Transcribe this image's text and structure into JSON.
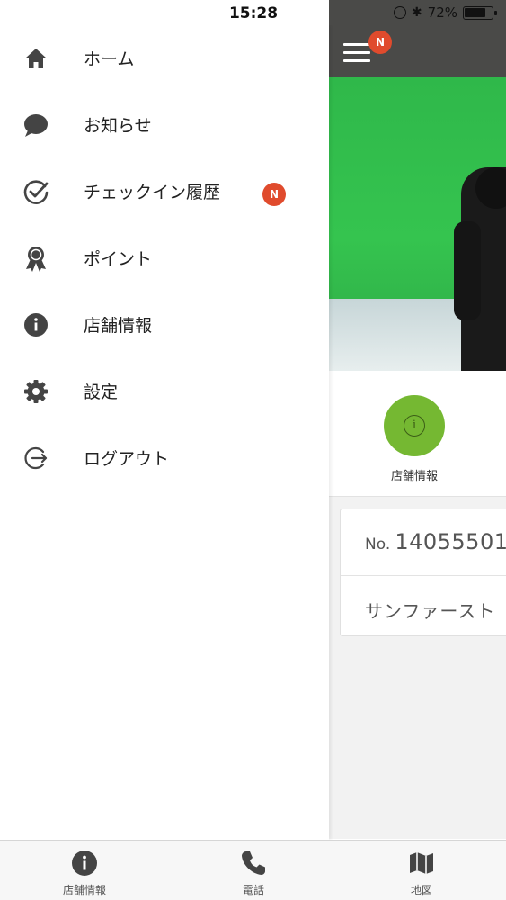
{
  "status_bar": {
    "time": "15:28",
    "battery": "72%"
  },
  "app": {
    "header_badge": "N",
    "store_info_label": "店舗情報",
    "member_no_prefix": "No.",
    "member_no": "14055501",
    "member_name": "サンファースト"
  },
  "drawer": {
    "items": [
      {
        "label": "ホーム",
        "icon": "home-icon"
      },
      {
        "label": "お知らせ",
        "icon": "speech-bubble-icon"
      },
      {
        "label": "チェックイン履歴",
        "icon": "check-circle-icon",
        "badge": "N"
      },
      {
        "label": "ポイント",
        "icon": "award-ribbon-icon"
      },
      {
        "label": "店舗情報",
        "icon": "info-icon"
      },
      {
        "label": "設定",
        "icon": "gear-icon"
      },
      {
        "label": "ログアウト",
        "icon": "logout-icon"
      }
    ]
  },
  "tab_bar": {
    "tabs": [
      {
        "label": "店舗情報",
        "icon": "info-icon"
      },
      {
        "label": "電話",
        "icon": "phone-icon"
      },
      {
        "label": "地図",
        "icon": "map-icon"
      }
    ]
  },
  "colors": {
    "accent_green": "#75b832",
    "badge_red": "#e04b2d",
    "header_dark": "#4a4a48",
    "icon_gray": "#444444"
  }
}
